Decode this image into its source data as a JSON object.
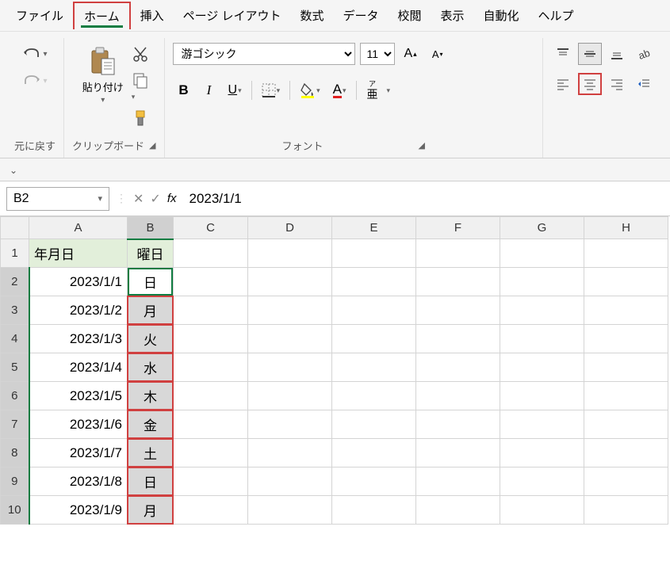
{
  "menu": {
    "items": [
      "ファイル",
      "ホーム",
      "挿入",
      "ページ レイアウト",
      "数式",
      "データ",
      "校閲",
      "表示",
      "自動化",
      "ヘルプ"
    ],
    "active_index": 1
  },
  "ribbon": {
    "undo_label": "元に戻す",
    "clipboard_label": "クリップボード",
    "paste_label": "貼り付け",
    "font_label": "フォント",
    "font_name": "游ゴシック",
    "font_size": "11",
    "phonetic_label": "ア\n亜"
  },
  "namebox": "B2",
  "formula": "2023/1/1",
  "columns": [
    "A",
    "B",
    "C",
    "D",
    "E",
    "F",
    "G",
    "H"
  ],
  "rows": [
    {
      "n": 1,
      "A": "年月日",
      "B": "曜日",
      "header": true
    },
    {
      "n": 2,
      "A": "2023/1/1",
      "B": "日"
    },
    {
      "n": 3,
      "A": "2023/1/2",
      "B": "月"
    },
    {
      "n": 4,
      "A": "2023/1/3",
      "B": "火"
    },
    {
      "n": 5,
      "A": "2023/1/4",
      "B": "水"
    },
    {
      "n": 6,
      "A": "2023/1/5",
      "B": "木"
    },
    {
      "n": 7,
      "A": "2023/1/6",
      "B": "金"
    },
    {
      "n": 8,
      "A": "2023/1/7",
      "B": "土"
    },
    {
      "n": 9,
      "A": "2023/1/8",
      "B": "日"
    },
    {
      "n": 10,
      "A": "2023/1/9",
      "B": "月"
    }
  ],
  "active_cell": "B2",
  "selection_col": "B",
  "selection_rows": [
    2,
    3,
    4,
    5,
    6,
    7,
    8,
    9,
    10
  ]
}
